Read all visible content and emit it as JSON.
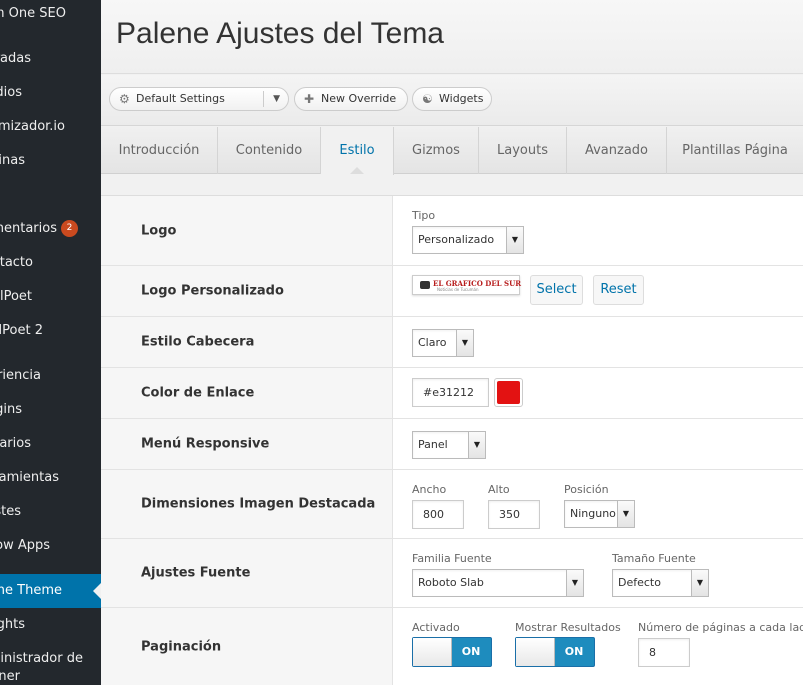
{
  "sidebar": {
    "items": [
      {
        "label": "m One SEO"
      },
      {
        "label": "radas"
      },
      {
        "label": "dios"
      },
      {
        "label": "mizador.io"
      },
      {
        "label": "inas"
      },
      {
        "label": "mentarios",
        "badge": "2"
      },
      {
        "label": "ntacto"
      },
      {
        "label": "lPoet"
      },
      {
        "label": "lPoet 2"
      },
      {
        "label": "riencia"
      },
      {
        "label": "gins"
      },
      {
        "label": "arios"
      },
      {
        "label": "ramientas"
      },
      {
        "label": "stes"
      },
      {
        "label": "ow Apps"
      },
      {
        "label": "ene Theme",
        "active": true
      },
      {
        "label": "ghts"
      },
      {
        "label": "ninistrador de"
      },
      {
        "label": "ner"
      }
    ]
  },
  "header": {
    "title": "Palene Ajustes del Tema"
  },
  "toolbar": {
    "settings_label": "Default Settings",
    "override_label": "New Override",
    "widgets_label": "Widgets"
  },
  "tabs": [
    {
      "label": "Introducción"
    },
    {
      "label": "Contenido"
    },
    {
      "label": "Estilo",
      "active": true
    },
    {
      "label": "Gizmos"
    },
    {
      "label": "Layouts"
    },
    {
      "label": "Avanzado"
    },
    {
      "label": "Plantillas Página"
    }
  ],
  "rows": {
    "logo": {
      "label": "Logo",
      "tipo_label": "Tipo",
      "tipo_value": "Personalizado"
    },
    "logo_custom": {
      "label": "Logo Personalizado",
      "logo_text": "EL GRAFICO DEL SUR",
      "logo_sub": "Noticias de Tucumán",
      "select_label": "Select",
      "reset_label": "Reset"
    },
    "header_style": {
      "label": "Estilo Cabecera",
      "value": "Claro"
    },
    "link_color": {
      "label": "Color de Enlace",
      "value": "#e31212",
      "swatch": "#e31212"
    },
    "responsive_menu": {
      "label": "Menú Responsive",
      "value": "Panel"
    },
    "featured_image": {
      "label": "Dimensiones Imagen Destacada",
      "width_label": "Ancho",
      "width_value": "800",
      "height_label": "Alto",
      "height_value": "350",
      "position_label": "Posición",
      "position_value": "Ninguno"
    },
    "font": {
      "label": "Ajustes Fuente",
      "family_label": "Familia Fuente",
      "family_value": "Roboto Slab",
      "size_label": "Tamaño Fuente",
      "size_value": "Defecto"
    },
    "pagination": {
      "label": "Paginación",
      "enabled_label": "Activado",
      "enabled_state": "ON",
      "results_label": "Mostrar Resultados",
      "results_state": "ON",
      "pages_label": "Número de páginas a cada lado",
      "pages_value": "8"
    }
  },
  "colors": {
    "accent": "#0073aa",
    "sidebar_bg": "#23282d",
    "toggle_on": "#1e8cbe"
  }
}
